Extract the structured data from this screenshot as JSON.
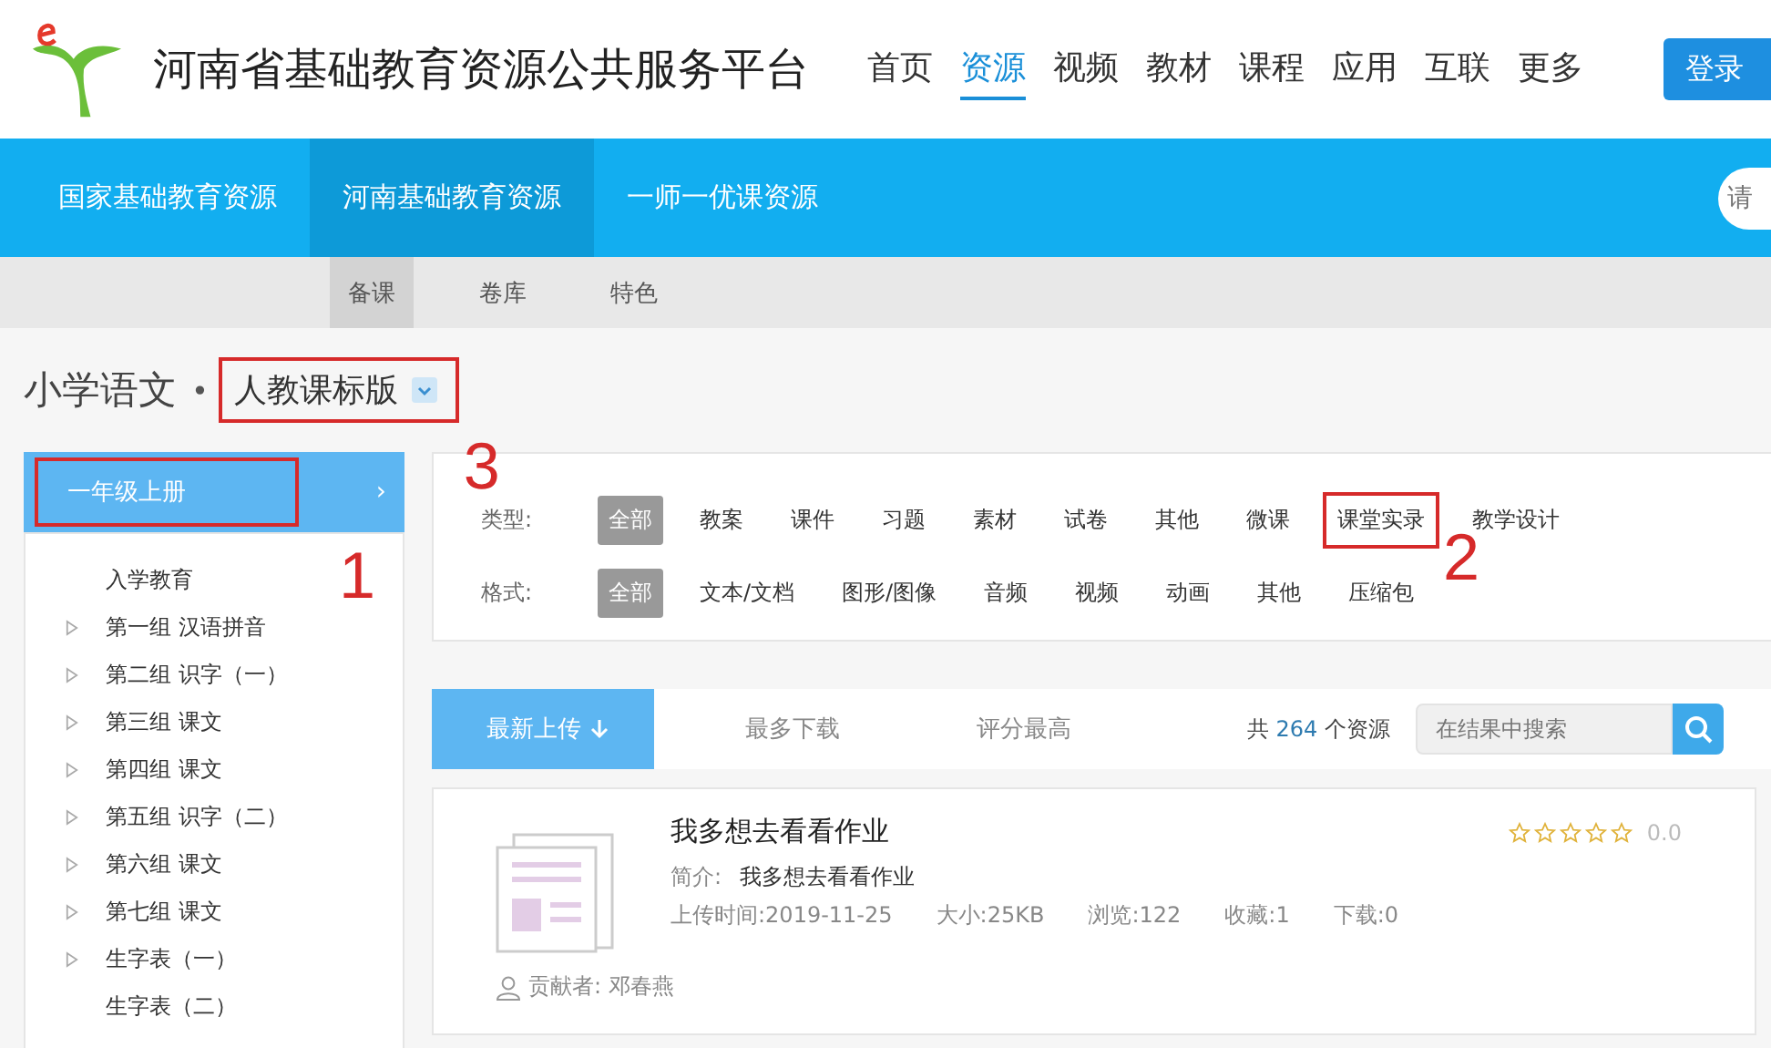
{
  "header": {
    "site_title": "河南省基础教育资源公共服务平台",
    "nav": [
      {
        "label": "首页",
        "selected": false
      },
      {
        "label": "资源",
        "selected": true
      },
      {
        "label": "视频",
        "selected": false
      },
      {
        "label": "教材",
        "selected": false
      },
      {
        "label": "课程",
        "selected": false
      },
      {
        "label": "应用",
        "selected": false
      },
      {
        "label": "互联",
        "selected": false
      },
      {
        "label": "更多",
        "selected": false
      }
    ],
    "login_button": "登录"
  },
  "source_tabs": [
    {
      "label": "国家基础教育资源",
      "selected": false
    },
    {
      "label": "河南基础教育资源",
      "selected": true
    },
    {
      "label": "一师一优课资源",
      "selected": false
    }
  ],
  "top_search": {
    "placeholder": "请"
  },
  "sub_tabs": [
    {
      "label": "备课",
      "selected": true
    },
    {
      "label": "卷库",
      "selected": false
    },
    {
      "label": "特色",
      "selected": false
    }
  ],
  "breadcrumb": {
    "subject": "小学语文",
    "separator": "•",
    "edition": "人教课标版",
    "annotation": "3"
  },
  "sidebar": {
    "grade": {
      "label": "一年级上册",
      "chevron": "›",
      "selected": true,
      "annotation": "1"
    },
    "items": [
      {
        "label": "入学教育",
        "expandable": false
      },
      {
        "label": "第一组 汉语拼音",
        "expandable": true
      },
      {
        "label": "第二组 识字（一）",
        "expandable": true
      },
      {
        "label": "第三组 课文",
        "expandable": true
      },
      {
        "label": "第四组 课文",
        "expandable": true
      },
      {
        "label": "第五组 识字（二）",
        "expandable": true
      },
      {
        "label": "第六组 课文",
        "expandable": true
      },
      {
        "label": "第七组 课文",
        "expandable": true
      },
      {
        "label": "生字表（一）",
        "expandable": true
      },
      {
        "label": "生字表（二）",
        "expandable": false
      }
    ]
  },
  "filters": [
    {
      "label": "类型:",
      "options": [
        {
          "label": "全部",
          "selected": true
        },
        {
          "label": "教案",
          "selected": false
        },
        {
          "label": "课件",
          "selected": false
        },
        {
          "label": "习题",
          "selected": false
        },
        {
          "label": "素材",
          "selected": false
        },
        {
          "label": "试卷",
          "selected": false
        },
        {
          "label": "其他",
          "selected": false
        },
        {
          "label": "微课",
          "selected": false
        },
        {
          "label": "课堂实录",
          "selected": false,
          "annotation": "2"
        },
        {
          "label": "教学设计",
          "selected": false
        }
      ]
    },
    {
      "label": "格式:",
      "options": [
        {
          "label": "全部",
          "selected": true
        },
        {
          "label": "文本/文档",
          "selected": false
        },
        {
          "label": "图形/图像",
          "selected": false
        },
        {
          "label": "音频",
          "selected": false
        },
        {
          "label": "视频",
          "selected": false
        },
        {
          "label": "动画",
          "selected": false
        },
        {
          "label": "其他",
          "selected": false
        },
        {
          "label": "压缩包",
          "selected": false
        }
      ]
    }
  ],
  "sort": {
    "options": [
      {
        "label": "最新上传",
        "selected": true
      },
      {
        "label": "最多下载",
        "selected": false
      },
      {
        "label": "评分最高",
        "selected": false
      }
    ],
    "count_prefix": "共",
    "count": "264",
    "count_suffix": "个资源",
    "search_placeholder": "在结果中搜索"
  },
  "resources": [
    {
      "title": "我多想去看看作业",
      "summary_label": "简介:",
      "summary": "我多想去看看作业",
      "meta": [
        {
          "label": "上传时间:",
          "value": "2019-11-25"
        },
        {
          "label": "大小:",
          "value": "25KB"
        },
        {
          "label": "浏览:",
          "value": "122"
        },
        {
          "label": "收藏:",
          "value": "1"
        },
        {
          "label": "下载:",
          "value": "0"
        }
      ],
      "stars": 0,
      "rating": "0.0",
      "contributor_label": "贡献者:",
      "contributor": "邓春燕"
    }
  ]
}
